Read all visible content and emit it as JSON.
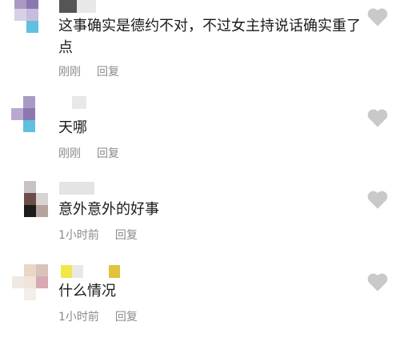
{
  "colors": {
    "text": "#1a1a1a",
    "meta": "#8a8a8a",
    "heart": "#c9c9c9"
  },
  "comments": [
    {
      "avatar_icon": "blurred-avatar",
      "content": "这事确实是德约不对，不过女主持说话确实重了点",
      "time": "刚刚",
      "reply": "回复",
      "like_icon": "heart-icon"
    },
    {
      "avatar_icon": "blurred-avatar",
      "content": "天哪",
      "time": "刚刚",
      "reply": "回复",
      "like_icon": "heart-icon"
    },
    {
      "avatar_icon": "blurred-avatar",
      "content": "意外意外的好事",
      "time": "1小时前",
      "reply": "回复",
      "like_icon": "heart-icon"
    },
    {
      "avatar_icon": "blurred-avatar",
      "content": "什么情况",
      "time": "1小时前",
      "reply": "回复",
      "like_icon": "heart-icon"
    }
  ]
}
